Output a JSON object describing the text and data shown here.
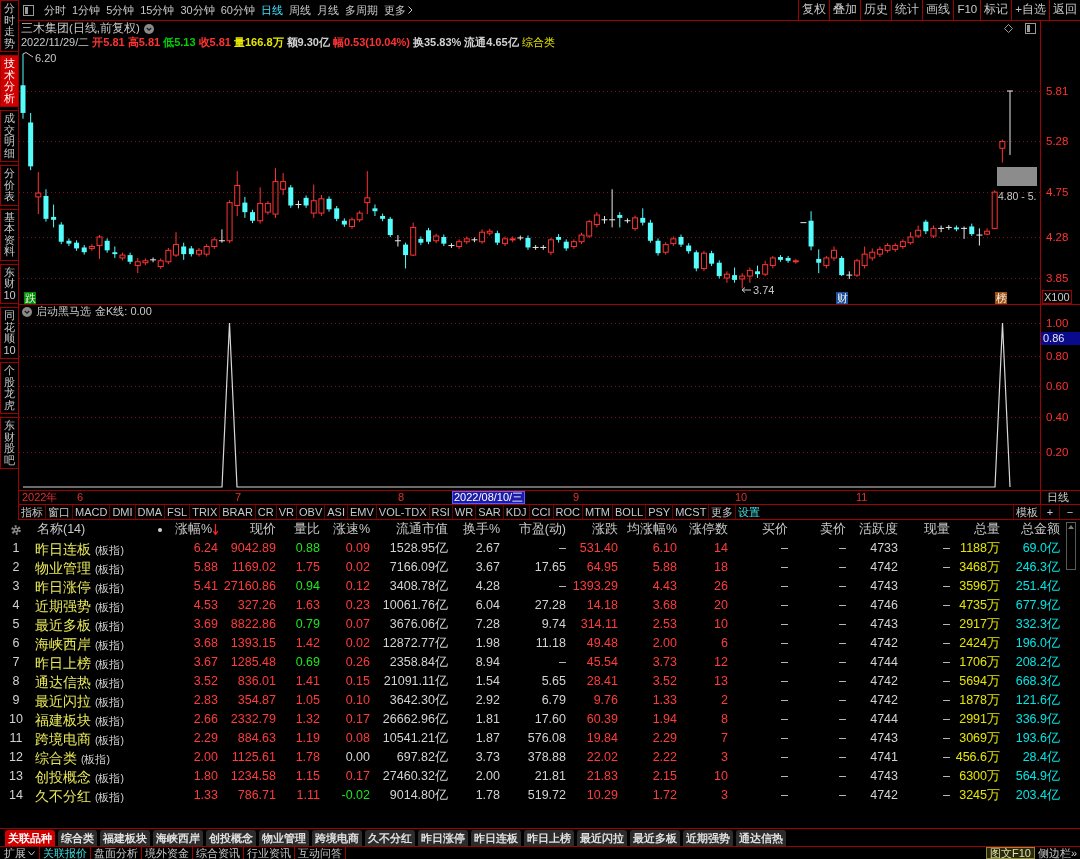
{
  "sidebar": {
    "tabs": [
      {
        "label": "分时走势",
        "selected": false
      },
      {
        "label": "技术分析",
        "selected": true
      },
      {
        "label": "成交明细",
        "selected": false
      },
      {
        "label": "分价表",
        "selected": false
      },
      {
        "label": "基本资料",
        "selected": false
      },
      {
        "label": "东财10",
        "selected": false
      },
      {
        "label": "同花顺10",
        "selected": false
      },
      {
        "label": "个股龙虎",
        "selected": false
      },
      {
        "label": "东财股吧",
        "selected": false
      }
    ]
  },
  "toolbar": {
    "periods": [
      {
        "label": "分时",
        "selected": false
      },
      {
        "label": "1分钟",
        "selected": false
      },
      {
        "label": "5分钟",
        "selected": false
      },
      {
        "label": "15分钟",
        "selected": false
      },
      {
        "label": "30分钟",
        "selected": false
      },
      {
        "label": "60分钟",
        "selected": false
      },
      {
        "label": "日线",
        "selected": true
      },
      {
        "label": "周线",
        "selected": false
      },
      {
        "label": "月线",
        "selected": false
      },
      {
        "label": "多周期",
        "selected": false
      }
    ],
    "more": "更多",
    "actions": [
      "复权",
      "叠加",
      "历史",
      "统计",
      "画线",
      "F10",
      "标记",
      "+自选",
      "返回"
    ]
  },
  "price_chart": {
    "title": "三木集团(日线,前复权)",
    "date": "2022/11/29/二",
    "quotes": [
      {
        "label": "开",
        "value": "5.81",
        "color": "#ff3232"
      },
      {
        "label": "高",
        "value": "5.81",
        "color": "#ff3232"
      },
      {
        "label": "低",
        "value": "5.13",
        "color": "#00d200"
      },
      {
        "label": "收",
        "value": "5.81",
        "color": "#ff3232"
      },
      {
        "label": "量",
        "value": "166.8万",
        "color": "#e6e600"
      },
      {
        "label": "额",
        "value": "9.30亿",
        "color": "#d2d2d2"
      },
      {
        "label": "幅",
        "value": "0.53(10.04%)",
        "color": "#ff3232"
      },
      {
        "label": "换",
        "value": "35.83%",
        "color": "#d2d2d2"
      },
      {
        "label": "流通",
        "value": "4.65亿",
        "color": "#d2d2d2"
      }
    ],
    "sector": "综合类",
    "high_note": "6.20",
    "low_note": "3.74",
    "zone_label": "4.80 - 5.",
    "markers": [
      {
        "text": "跌",
        "color": "#008c00"
      },
      {
        "text": "财",
        "color": "#1d4f9a"
      },
      {
        "text": "榜",
        "color": "#a0520f"
      }
    ],
    "axis_labels": [
      "5.81",
      "5.28",
      "4.75",
      "4.28",
      "3.85"
    ],
    "scale": "X100"
  },
  "indicator": {
    "title": "启动黑马选",
    "reading": "金K线: 0.00",
    "axis_labels": [
      "1.00",
      "0.80",
      "0.60",
      "0.40",
      "0.20"
    ],
    "cursor_value": "0.86"
  },
  "date_axis": {
    "labels": [
      "2022年",
      "6",
      "7",
      "8",
      "9",
      "10",
      "11"
    ],
    "cursor_date": "2022/08/10/三",
    "period": "日线"
  },
  "indicator_tabs": {
    "tabs": [
      "指标",
      "窗口",
      "MACD",
      "DMI",
      "DMA",
      "FSL",
      "TRIX",
      "BRAR",
      "CR",
      "VR",
      "OBV",
      "ASI",
      "EMV",
      "VOL-TDX",
      "RSI",
      "WR",
      "SAR",
      "KDJ",
      "CCI",
      "ROC",
      "MTM",
      "BOLL",
      "PSY",
      "MCST",
      "更多"
    ],
    "settings": "设置",
    "template": "模板",
    "add": "+",
    "remove": "−"
  },
  "table": {
    "name_header": "名称(14)",
    "columns": [
      {
        "label": "涨幅%",
        "kind": "change",
        "sorted": true
      },
      {
        "label": "现价",
        "kind": "change",
        "sorted": false
      },
      {
        "label": "量比",
        "kind": "ratio",
        "sorted": false
      },
      {
        "label": "涨速%",
        "kind": "speed",
        "sorted": false
      },
      {
        "label": "流通市值",
        "kind": "plain",
        "sorted": false
      },
      {
        "label": "换手%",
        "kind": "plain",
        "sorted": false
      },
      {
        "label": "市盈(动)",
        "kind": "plain",
        "sorted": false
      },
      {
        "label": "涨跌",
        "kind": "change",
        "sorted": false
      },
      {
        "label": "均涨幅%",
        "kind": "change",
        "sorted": false
      },
      {
        "label": "涨停数",
        "kind": "change",
        "sorted": false
      },
      {
        "label": "买价",
        "kind": "plain",
        "sorted": false
      },
      {
        "label": "卖价",
        "kind": "plain",
        "sorted": false
      },
      {
        "label": "活跃度",
        "kind": "plain",
        "sorted": false
      },
      {
        "label": "现量",
        "kind": "plain",
        "sorted": false
      },
      {
        "label": "总量",
        "kind": "volume",
        "sorted": false
      },
      {
        "label": "总金额",
        "kind": "amount",
        "sorted": false
      }
    ],
    "rows": [
      {
        "rank": "1",
        "name": "昨日连板",
        "tag": "(板指)",
        "rising": true,
        "volume_ratio_high": false,
        "speed_up": true,
        "speed_down": false,
        "cells": [
          "6.24",
          "9042.89",
          "0.88",
          "0.09",
          "1528.95亿",
          "2.67",
          "–",
          "531.40",
          "6.10",
          "14",
          "–",
          "–",
          "4733",
          "–",
          "1188万",
          "69.0亿"
        ]
      },
      {
        "rank": "2",
        "name": "物业管理",
        "tag": "(板指)",
        "rising": true,
        "volume_ratio_high": true,
        "speed_up": true,
        "speed_down": false,
        "cells": [
          "5.88",
          "1169.02",
          "1.75",
          "0.02",
          "7166.09亿",
          "3.67",
          "17.65",
          "64.95",
          "5.88",
          "18",
          "–",
          "–",
          "4742",
          "–",
          "3468万",
          "246.3亿"
        ]
      },
      {
        "rank": "3",
        "name": "昨日涨停",
        "tag": "(板指)",
        "rising": true,
        "volume_ratio_high": false,
        "speed_up": true,
        "speed_down": false,
        "cells": [
          "5.41",
          "27160.86",
          "0.94",
          "0.12",
          "3408.78亿",
          "4.28",
          "–",
          "1393.29",
          "4.43",
          "26",
          "–",
          "–",
          "4743",
          "–",
          "3596万",
          "251.4亿"
        ]
      },
      {
        "rank": "4",
        "name": "近期强势",
        "tag": "(板指)",
        "rising": true,
        "volume_ratio_high": true,
        "speed_up": true,
        "speed_down": false,
        "cells": [
          "4.53",
          "327.26",
          "1.63",
          "0.23",
          "10061.76亿",
          "6.04",
          "27.28",
          "14.18",
          "3.68",
          "20",
          "–",
          "–",
          "4746",
          "–",
          "4735万",
          "677.9亿"
        ]
      },
      {
        "rank": "5",
        "name": "最近多板",
        "tag": "(板指)",
        "rising": true,
        "volume_ratio_high": false,
        "speed_up": true,
        "speed_down": false,
        "cells": [
          "3.69",
          "8822.86",
          "0.79",
          "0.07",
          "3676.06亿",
          "7.28",
          "9.74",
          "314.11",
          "2.53",
          "10",
          "–",
          "–",
          "4743",
          "–",
          "2917万",
          "332.3亿"
        ]
      },
      {
        "rank": "6",
        "name": "海峡西岸",
        "tag": "(板指)",
        "rising": true,
        "volume_ratio_high": true,
        "speed_up": true,
        "speed_down": false,
        "cells": [
          "3.68",
          "1393.15",
          "1.42",
          "0.02",
          "12872.77亿",
          "1.98",
          "11.18",
          "49.48",
          "2.00",
          "6",
          "–",
          "–",
          "4742",
          "–",
          "2424万",
          "196.0亿"
        ]
      },
      {
        "rank": "7",
        "name": "昨日上榜",
        "tag": "(板指)",
        "rising": true,
        "volume_ratio_high": false,
        "speed_up": true,
        "speed_down": false,
        "cells": [
          "3.67",
          "1285.48",
          "0.69",
          "0.26",
          "2358.84亿",
          "8.94",
          "–",
          "45.54",
          "3.73",
          "12",
          "–",
          "–",
          "4744",
          "–",
          "1706万",
          "208.2亿"
        ]
      },
      {
        "rank": "8",
        "name": "通达信热",
        "tag": "(板指)",
        "rising": true,
        "volume_ratio_high": true,
        "speed_up": true,
        "speed_down": false,
        "cells": [
          "3.52",
          "836.01",
          "1.41",
          "0.15",
          "21091.11亿",
          "1.54",
          "5.65",
          "28.41",
          "3.52",
          "13",
          "–",
          "–",
          "4742",
          "–",
          "5694万",
          "668.3亿"
        ]
      },
      {
        "rank": "9",
        "name": "最近闪拉",
        "tag": "(板指)",
        "rising": true,
        "volume_ratio_high": true,
        "speed_up": true,
        "speed_down": false,
        "cells": [
          "2.83",
          "354.87",
          "1.05",
          "0.10",
          "3642.30亿",
          "2.92",
          "6.79",
          "9.76",
          "1.33",
          "2",
          "–",
          "–",
          "4742",
          "–",
          "1878万",
          "121.6亿"
        ]
      },
      {
        "rank": "10",
        "name": "福建板块",
        "tag": "(板指)",
        "rising": true,
        "volume_ratio_high": true,
        "speed_up": true,
        "speed_down": false,
        "cells": [
          "2.66",
          "2332.79",
          "1.32",
          "0.17",
          "26662.96亿",
          "1.81",
          "17.60",
          "60.39",
          "1.94",
          "8",
          "–",
          "–",
          "4744",
          "–",
          "2991万",
          "336.9亿"
        ]
      },
      {
        "rank": "11",
        "name": "跨境电商",
        "tag": "(板指)",
        "rising": true,
        "volume_ratio_high": true,
        "speed_up": true,
        "speed_down": false,
        "cells": [
          "2.29",
          "884.63",
          "1.19",
          "0.08",
          "10541.21亿",
          "1.87",
          "576.08",
          "19.84",
          "2.29",
          "7",
          "–",
          "–",
          "4743",
          "–",
          "3069万",
          "193.6亿"
        ]
      },
      {
        "rank": "12",
        "name": "综合类",
        "tag": "(板指)",
        "rising": true,
        "volume_ratio_high": true,
        "speed_up": false,
        "speed_down": false,
        "cells": [
          "2.00",
          "1125.61",
          "1.78",
          "0.00",
          "697.82亿",
          "3.73",
          "378.88",
          "22.02",
          "2.22",
          "3",
          "–",
          "–",
          "4741",
          "–",
          "456.6万",
          "28.4亿"
        ]
      },
      {
        "rank": "13",
        "name": "创投概念",
        "tag": "(板指)",
        "rising": true,
        "volume_ratio_high": true,
        "speed_up": true,
        "speed_down": false,
        "cells": [
          "1.80",
          "1234.58",
          "1.15",
          "0.17",
          "27460.32亿",
          "2.00",
          "21.81",
          "21.83",
          "2.15",
          "10",
          "–",
          "–",
          "4743",
          "–",
          "6300万",
          "564.9亿"
        ]
      },
      {
        "rank": "14",
        "name": "久不分红",
        "tag": "(板指)",
        "rising": true,
        "volume_ratio_high": true,
        "speed_up": false,
        "speed_down": true,
        "cells": [
          "1.33",
          "786.71",
          "1.11",
          "-0.02",
          "9014.80亿",
          "1.78",
          "519.72",
          "10.29",
          "1.72",
          "3",
          "–",
          "–",
          "4742",
          "–",
          "3245万",
          "203.4亿"
        ]
      }
    ]
  },
  "bottom_tabs": [
    {
      "label": "关联品种",
      "selected": true
    },
    {
      "label": "综合类",
      "selected": false
    },
    {
      "label": "福建板块",
      "selected": false
    },
    {
      "label": "海峡西岸",
      "selected": false
    },
    {
      "label": "创投概念",
      "selected": false
    },
    {
      "label": "物业管理",
      "selected": false
    },
    {
      "label": "跨境电商",
      "selected": false
    },
    {
      "label": "久不分红",
      "selected": false
    },
    {
      "label": "昨日涨停",
      "selected": false
    },
    {
      "label": "昨日连板",
      "selected": false
    },
    {
      "label": "昨日上榜",
      "selected": false
    },
    {
      "label": "最近闪拉",
      "selected": false
    },
    {
      "label": "最近多板",
      "selected": false
    },
    {
      "label": "近期强势",
      "selected": false
    },
    {
      "label": "通达信热",
      "selected": false
    }
  ],
  "status_bar": {
    "expand": "扩展",
    "links": [
      {
        "label": "关联报价",
        "selected": true
      },
      {
        "label": "盘面分析",
        "selected": false
      },
      {
        "label": "境外资金",
        "selected": false
      },
      {
        "label": "综合资讯",
        "selected": false
      },
      {
        "label": "行业资讯",
        "selected": false
      },
      {
        "label": "互动问答",
        "selected": false
      }
    ],
    "f10": "图文F10",
    "sidebar_toggle": "侧边栏»"
  }
}
